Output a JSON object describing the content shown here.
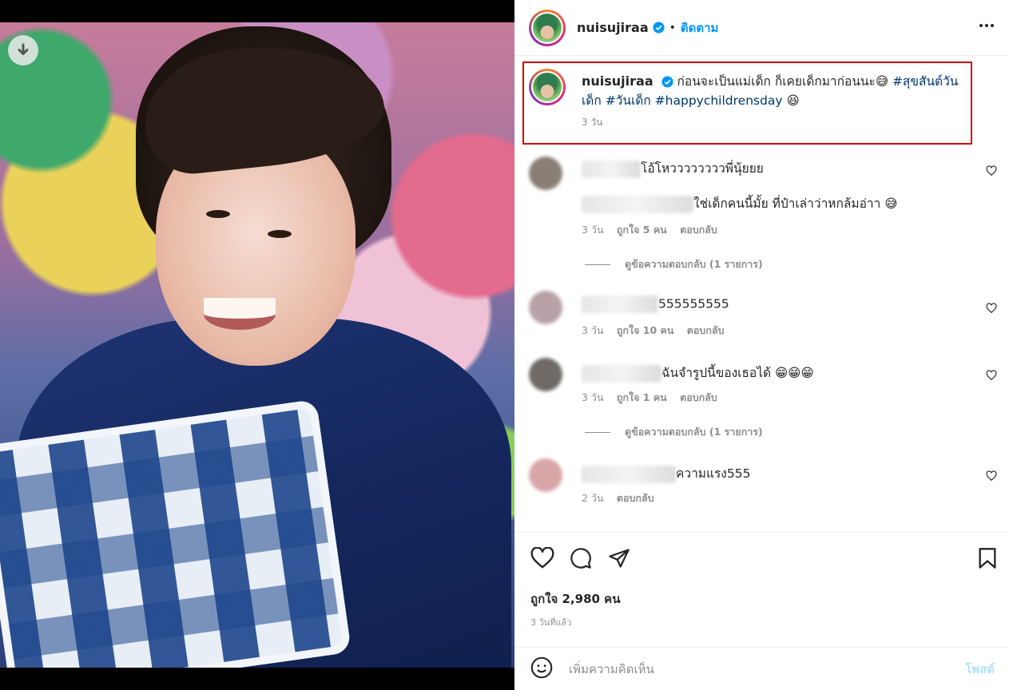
{
  "post": {
    "username": "nuisujiraa",
    "dot": "•",
    "follow_label": "ติดตาม",
    "caption_text": "ก่อนจะเป็นแม่เด็ก ก็เคยเด็กมาก่อนนะ😅",
    "hashtag1": "#สุขสันต์วันเด็ก",
    "hashtag2": "#วันเด็ก",
    "hashtag3": "#happychildrensday",
    "caption_emoji": "😆",
    "caption_time": "3 วัน"
  },
  "comments": [
    {
      "text": "โอ้โหววววววววพี่นุ้ยยย",
      "avatar_color": "#8a7f74"
    },
    {
      "text": "ใช่เด็กคนนี้มั้ย ที่ป๋าเล่าว่าหกล้มอ่าา 😅",
      "time": "3 วัน",
      "likes": "ถูกใจ 5 คน",
      "reply": "ตอบกลับ",
      "view_replies": "ดูข้อความตอบกลับ (1 รายการ)"
    },
    {
      "text": "555555555",
      "time": "3 วัน",
      "likes": "ถูกใจ 10 คน",
      "reply": "ตอบกลับ",
      "avatar_color": "#b8a2a8"
    },
    {
      "text": "ฉันจำรูปนี้ของเธอได้ 😁😁😁",
      "time": "3 วัน",
      "likes": "ถูกใจ 1 คน",
      "reply": "ตอบกลับ",
      "view_replies": "ดูข้อความตอบกลับ (1 รายการ)",
      "avatar_color": "#6f6a66"
    },
    {
      "text": "ความแรง555",
      "time": "2 วัน",
      "reply": "ตอบกลับ",
      "avatar_color": "#d9a6a8"
    }
  ],
  "footer": {
    "likes": "ถูกใจ 2,980 คน",
    "ago": "3 วันที่แล้ว",
    "comment_placeholder": "เพิ่มความคิดเห็น",
    "post_label": "โพสต์"
  },
  "colors": {
    "accent": "#0095f6",
    "highlight_border": "#d40000",
    "hashtag": "#00376b"
  }
}
